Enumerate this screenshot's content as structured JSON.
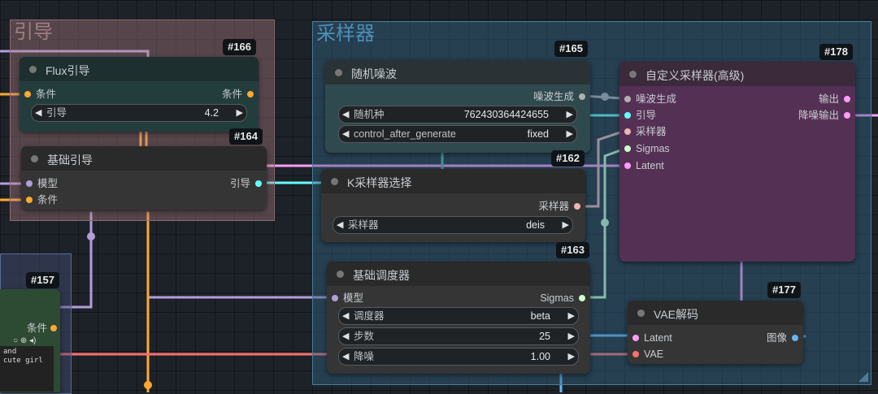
{
  "colors": {
    "clip": "#ffd500",
    "conditioning": "#ffa931",
    "model": "#b39ddb",
    "guider": "#66ffff",
    "sampler": "#ecb4b4",
    "sigmas": "#cdffcd",
    "latent": "#ff9cf9",
    "image": "#64b5f6",
    "vae": "#ff6e6e",
    "noise": "#b0b0b0"
  },
  "groups": {
    "guide": {
      "title": "引导"
    },
    "sampler": {
      "title": "采样器"
    }
  },
  "nodes": {
    "flux_guide": {
      "id": "#166",
      "title": "Flux引导",
      "input": "条件",
      "output": "条件",
      "widget": {
        "label": "引导",
        "value": "4.2"
      }
    },
    "basic_guider": {
      "id": "#164",
      "title": "基础引导",
      "inputs": [
        "模型",
        "条件"
      ],
      "output": "引导"
    },
    "random_noise": {
      "id": "#165",
      "title": "随机噪波",
      "output": "噪波生成",
      "widgets": [
        {
          "label": "随机种",
          "value": "762430364424655"
        },
        {
          "label": "control_after_generate",
          "value": "fixed"
        }
      ]
    },
    "ksampler_select": {
      "id": "#162",
      "title": "K采样器选择",
      "output": "采样器",
      "widget": {
        "label": "采样器",
        "value": "deis"
      }
    },
    "basic_scheduler": {
      "id": "#163",
      "title": "基础调度器",
      "input": "模型",
      "output": "Sigmas",
      "widgets": [
        {
          "label": "调度器",
          "value": "beta"
        },
        {
          "label": "步数",
          "value": "25"
        },
        {
          "label": "降噪",
          "value": "1.00"
        }
      ]
    },
    "custom_sampler": {
      "id": "#178",
      "title": "自定义采样器(高级)",
      "inputs": [
        "噪波生成",
        "引导",
        "采样器",
        "Sigmas",
        "Latent"
      ],
      "outputs": [
        "输出",
        "降噪输出"
      ]
    },
    "vae_decode": {
      "id": "#177",
      "title": "VAE解码",
      "inputs": [
        "Latent",
        "VAE"
      ],
      "output": "图像"
    },
    "clip_text": {
      "id": "#157",
      "output": "条件",
      "text_lines": [
        "and",
        "cute girl"
      ]
    }
  }
}
